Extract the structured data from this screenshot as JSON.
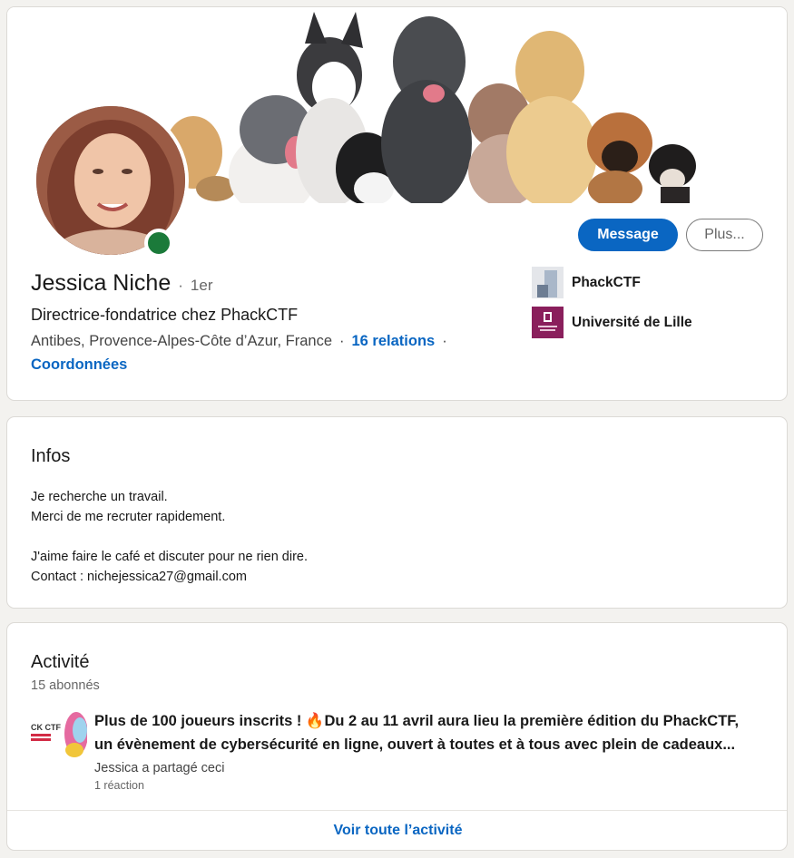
{
  "profile": {
    "name": "Jessica Niche",
    "degree_separator": "·",
    "degree": "1er",
    "headline": "Directrice-fondatrice chez PhackCTF",
    "location": "Antibes, Provence-Alpes-Côte d’Azur, France",
    "location_separator": "·",
    "connections": "16 relations",
    "connections_separator": "·",
    "contact_info": "Coordonnées",
    "status_color": "#1b7a3a"
  },
  "actions": {
    "message_label": "Message",
    "more_label": "Plus..."
  },
  "organizations": [
    {
      "name": "PhackCTF",
      "logo": "phackctf-logo"
    },
    {
      "name": "Université de Lille",
      "logo": "universite-de-lille-logo"
    }
  ],
  "infos": {
    "title": "Infos",
    "lines": [
      "Je recherche un travail.",
      "Merci de me recruter rapidement.",
      "",
      "J'aime faire le café et discuter pour ne rien dire.",
      "Contact : nichejessica27@gmail.com"
    ]
  },
  "activity": {
    "title": "Activité",
    "followers": "15 abonnés",
    "post": {
      "title_line1": "Plus de 100 joueurs inscrits ! 🔥Du 2 au 11 avril aura lieu la première édition du PhackCTF,",
      "title_line2": "un évènement de cybersécurité en ligne, ouvert à toutes et à tous avec plein de cadeaux...",
      "thumb_text": "CK CTF",
      "shared_by": "Jessica a partagé ceci",
      "reactions": "1 réaction"
    },
    "see_all": "Voir toute l’activité"
  },
  "colors": {
    "accent": "#0a66c2",
    "page_background": "#f3f2ef",
    "card_background": "#ffffff"
  }
}
